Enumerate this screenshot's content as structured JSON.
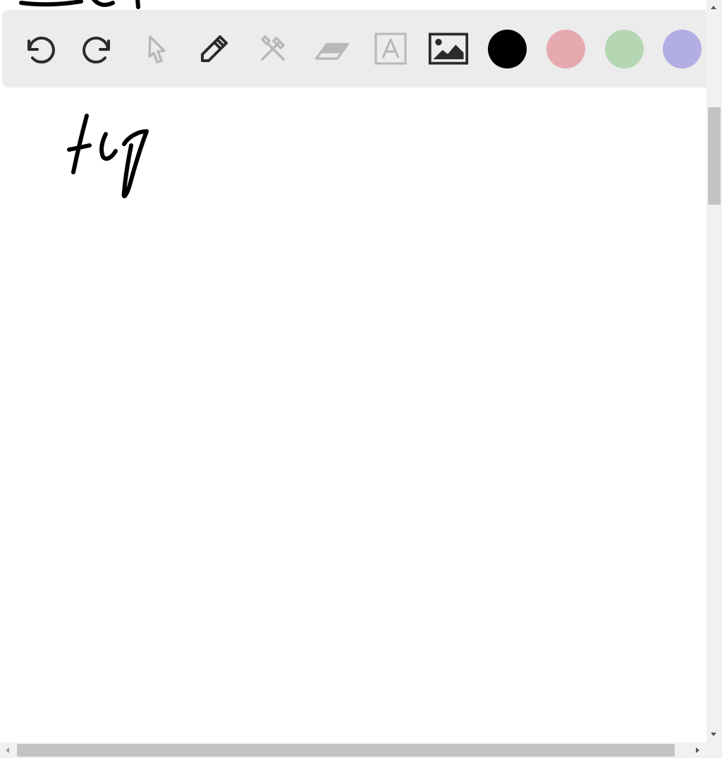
{
  "toolbar": {
    "tools": [
      {
        "id": "undo",
        "icon": "undo-icon",
        "enabled": true
      },
      {
        "id": "redo",
        "icon": "redo-icon",
        "enabled": true
      },
      {
        "id": "select",
        "icon": "pointer-icon",
        "enabled": false
      },
      {
        "id": "pen",
        "icon": "pencil-icon",
        "enabled": true
      },
      {
        "id": "tools",
        "icon": "crossed-tools-icon",
        "enabled": false
      },
      {
        "id": "eraser",
        "icon": "eraser-icon",
        "enabled": false
      },
      {
        "id": "text",
        "icon": "text-box-icon",
        "enabled": false
      },
      {
        "id": "image",
        "icon": "image-icon",
        "enabled": true
      }
    ],
    "colors": [
      {
        "name": "black",
        "hex": "#000000",
        "selected": true
      },
      {
        "name": "pink",
        "hex": "#e6a9b0",
        "selected": false
      },
      {
        "name": "green",
        "hex": "#b5d6b3",
        "selected": false
      },
      {
        "name": "purple",
        "hex": "#b2ade3",
        "selected": false
      }
    ],
    "enabled_color": "#2b2b2b",
    "disabled_color": "#b8b8b8"
  },
  "canvas": {
    "ink_color": "#000000",
    "background": "#ffffff"
  }
}
